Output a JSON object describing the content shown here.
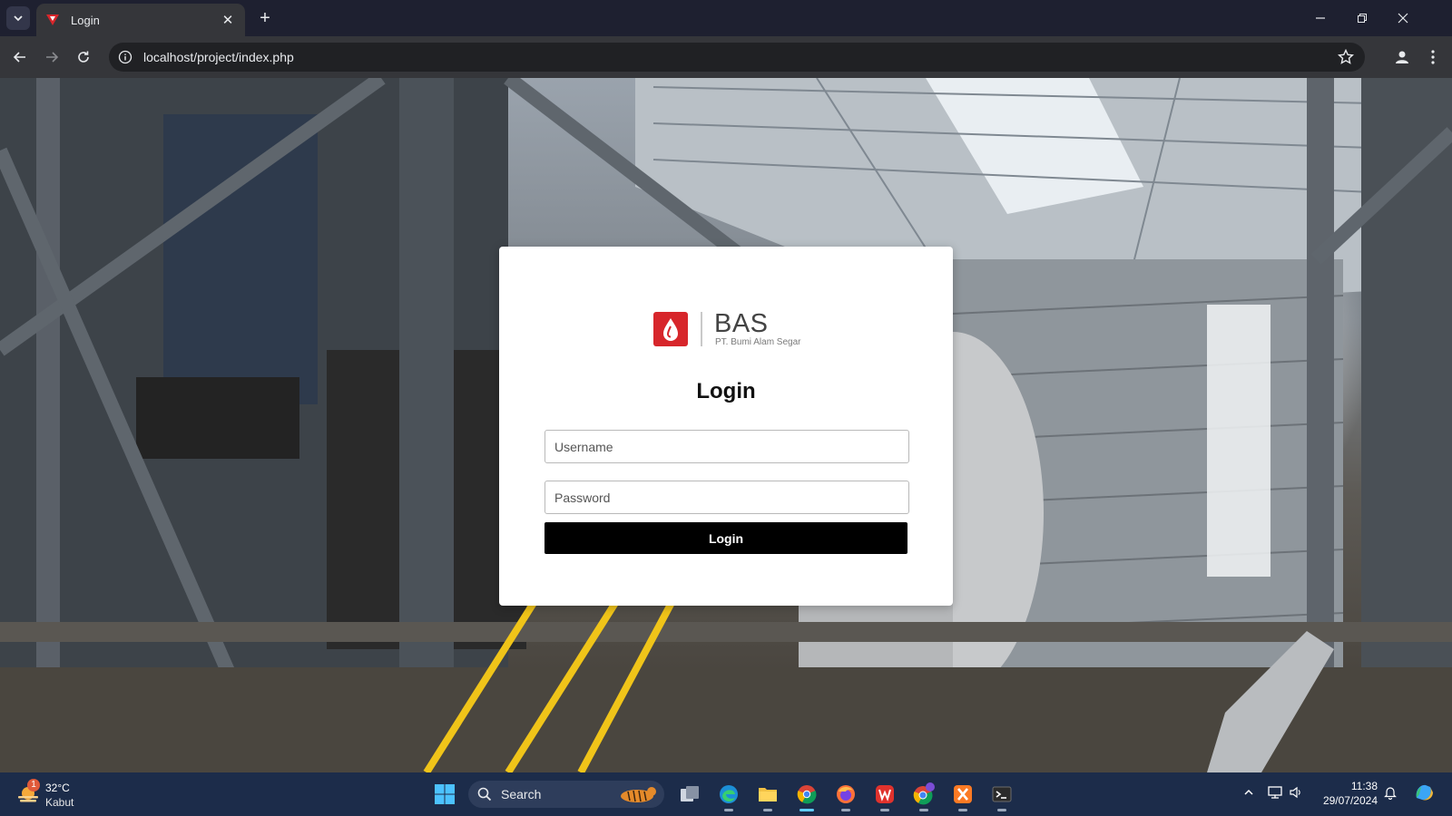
{
  "browser": {
    "tab_title": "Login",
    "url": "localhost/project/index.php"
  },
  "login": {
    "brand": "BAS",
    "company": "PT. Bumi Alam Segar",
    "title": "Login",
    "username_placeholder": "Username",
    "password_placeholder": "Password",
    "button_label": "Login"
  },
  "taskbar": {
    "weather_temp": "32°C",
    "weather_condition": "Kabut",
    "weather_badge": "1",
    "search_label": "Search",
    "time": "11:38",
    "date": "29/07/2024",
    "apps": [
      "windows-start",
      "search",
      "task-view",
      "edge",
      "file-explorer",
      "chrome",
      "firefox",
      "wps-office",
      "chrome-profile",
      "xampp",
      "terminal"
    ]
  },
  "colors": {
    "brand_red": "#d7262b",
    "button": "#000000",
    "taskbar": "#1c2c4a",
    "chrome_dark": "#35363a"
  }
}
